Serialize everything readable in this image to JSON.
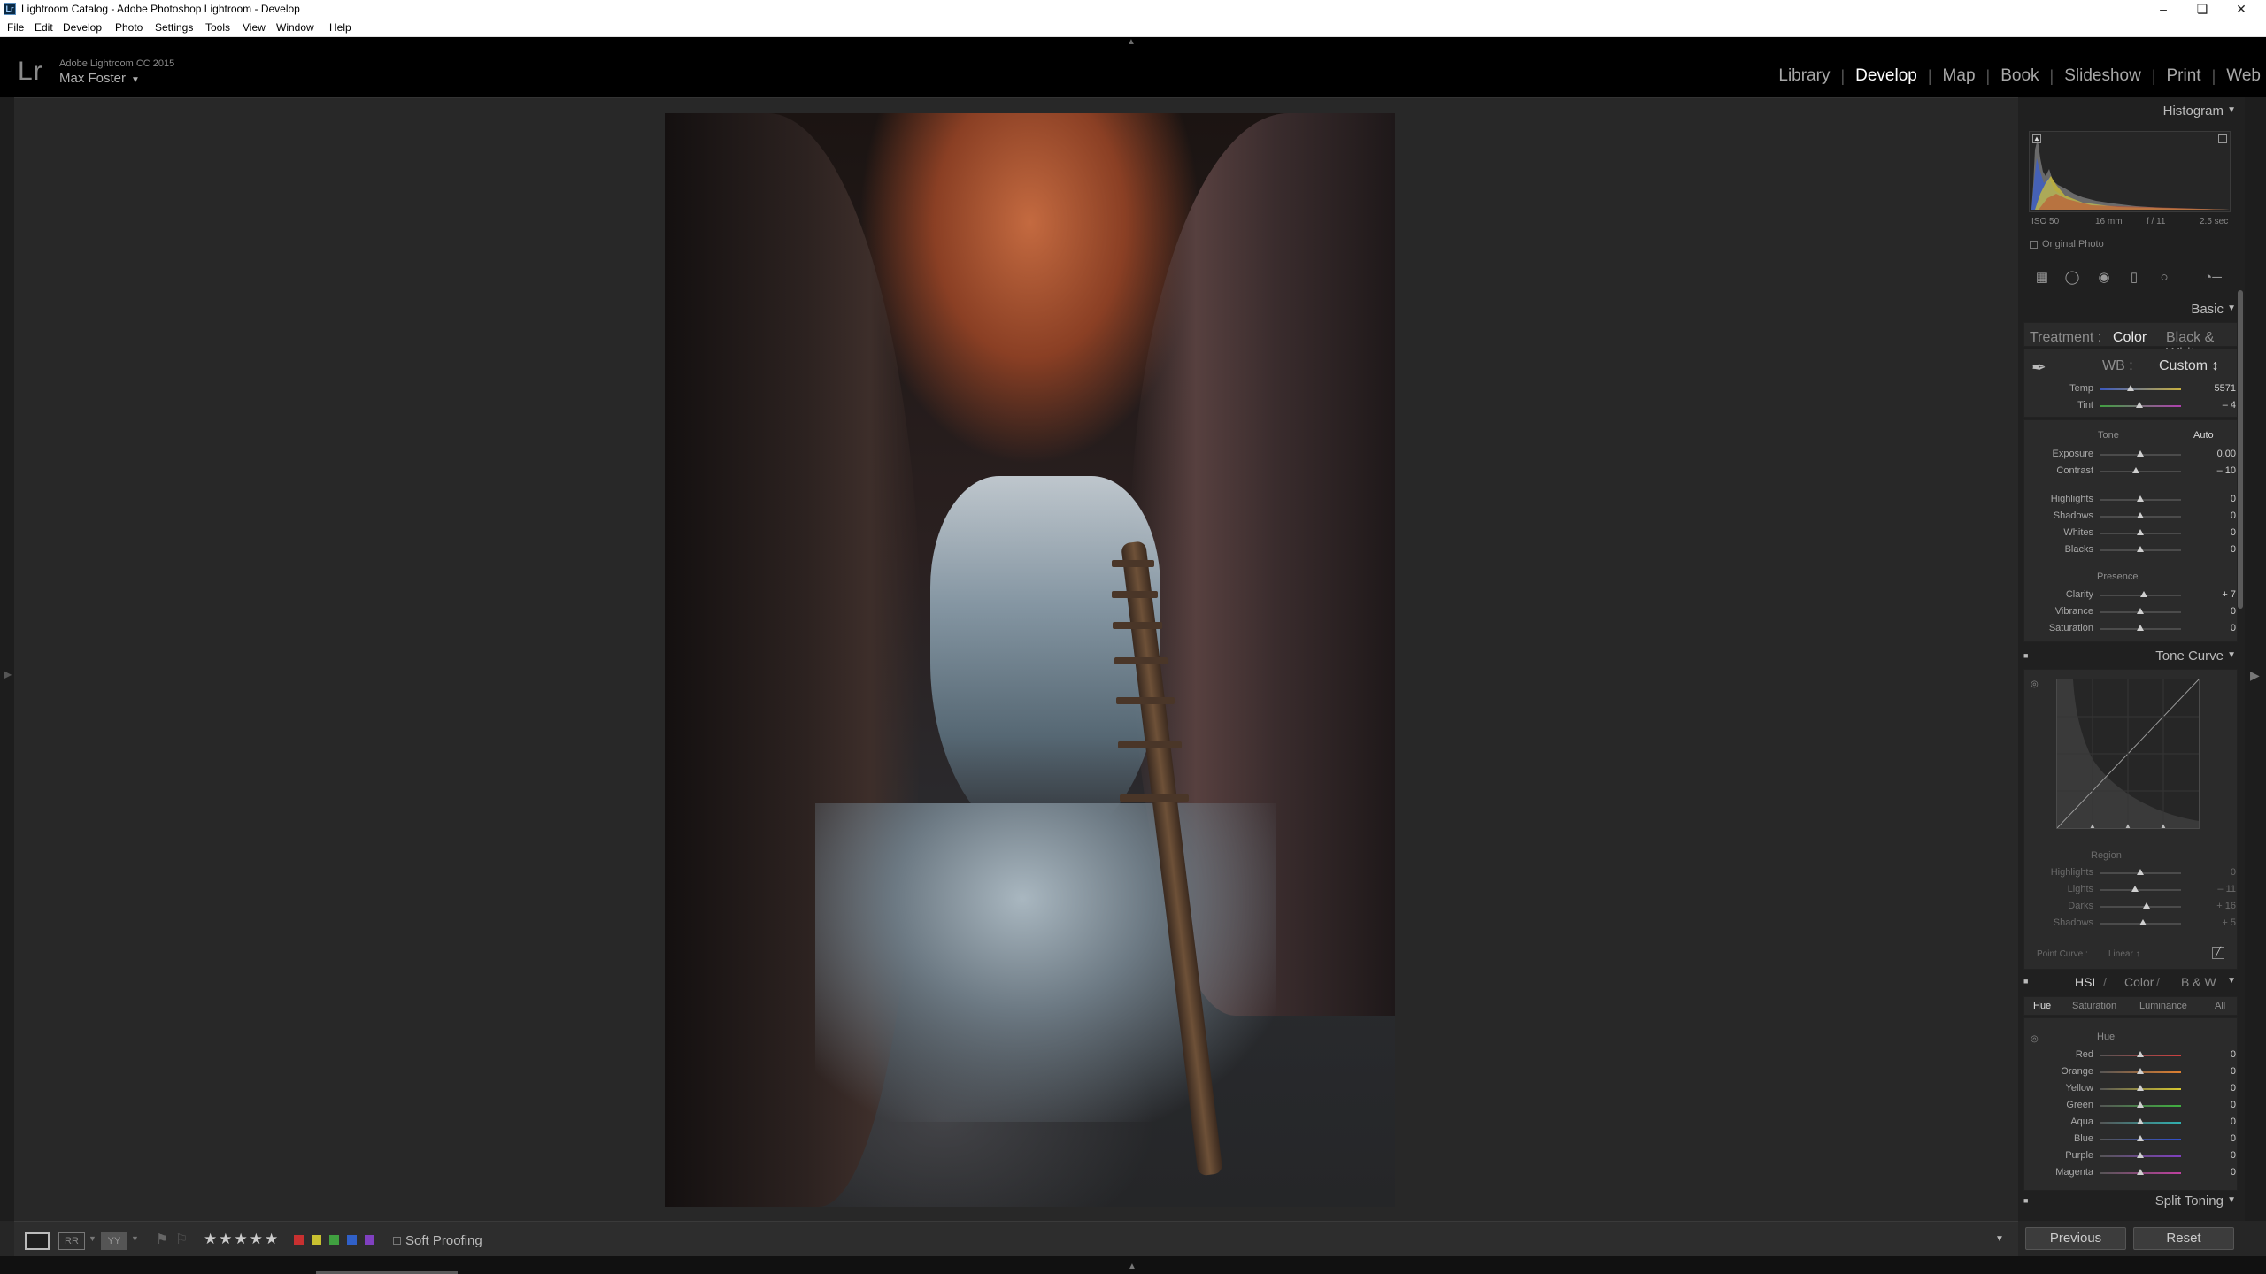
{
  "window": {
    "title": "Lightroom Catalog - Adobe Photoshop Lightroom - Develop",
    "app_icon": "Lr",
    "controls": [
      "–",
      "❏",
      "✕"
    ]
  },
  "menu": [
    "File",
    "Edit",
    "Develop",
    "Photo",
    "Settings",
    "Tools",
    "View",
    "Window",
    "Help"
  ],
  "identity": {
    "logo": "Lr",
    "product": "Adobe Lightroom CC 2015",
    "user": "Max Foster",
    "user_caret": "▼"
  },
  "modules": [
    "Library",
    "Develop",
    "Map",
    "Book",
    "Slideshow",
    "Print",
    "Web"
  ],
  "active_module": "Develop",
  "histogram": {
    "title": "Histogram",
    "exif": [
      "ISO 50",
      "16 mm",
      "f / 11",
      "2.5 sec"
    ],
    "original_photo": "Original Photo"
  },
  "basic": {
    "title": "Basic",
    "treatment_label": "Treatment :",
    "treatment_color": "Color",
    "treatment_bw": "Black & White",
    "wb_label": "WB :",
    "wb_value": "Custom ↕",
    "temp": {
      "label": "Temp",
      "value": "5571",
      "pos": 0.38
    },
    "tint": {
      "label": "Tint",
      "value": "– 4",
      "pos": 0.49
    },
    "tone_label": "Tone",
    "auto_label": "Auto",
    "tone_rows": [
      {
        "label": "Exposure",
        "value": "0.00",
        "pos": 0.5
      },
      {
        "label": "Contrast",
        "value": "– 10",
        "pos": 0.45
      }
    ],
    "light_rows": [
      {
        "label": "Highlights",
        "value": "0",
        "pos": 0.5
      },
      {
        "label": "Shadows",
        "value": "0",
        "pos": 0.5
      },
      {
        "label": "Whites",
        "value": "0",
        "pos": 0.5
      },
      {
        "label": "Blacks",
        "value": "0",
        "pos": 0.5
      }
    ],
    "presence_label": "Presence",
    "presence_rows": [
      {
        "label": "Clarity",
        "value": "+ 7",
        "pos": 0.54
      },
      {
        "label": "Vibrance",
        "value": "0",
        "pos": 0.5
      },
      {
        "label": "Saturation",
        "value": "0",
        "pos": 0.5
      }
    ]
  },
  "tone_curve": {
    "title": "Tone Curve",
    "region_label": "Region",
    "rows": [
      {
        "label": "Highlights",
        "value": "0",
        "pos": 0.5
      },
      {
        "label": "Lights",
        "value": "– 11",
        "pos": 0.44
      },
      {
        "label": "Darks",
        "value": "+ 16",
        "pos": 0.58
      },
      {
        "label": "Shadows",
        "value": "+ 5",
        "pos": 0.53
      }
    ],
    "point_curve_label": "Point Curve :",
    "point_curve_value": "Linear ↕"
  },
  "hsl": {
    "title_hsl": "HSL",
    "title_color": "Color",
    "title_bw": "B & W",
    "tabs": [
      "Hue",
      "Saturation",
      "Luminance",
      "All"
    ],
    "active_tab": "Hue",
    "group_label": "Hue",
    "rows": [
      {
        "label": "Red",
        "value": "0",
        "pos": 0.5,
        "color": "#d04040"
      },
      {
        "label": "Orange",
        "value": "0",
        "pos": 0.5,
        "color": "#e08030"
      },
      {
        "label": "Yellow",
        "value": "0",
        "pos": 0.5,
        "color": "#d8c830"
      },
      {
        "label": "Green",
        "value": "0",
        "pos": 0.5,
        "color": "#40b040"
      },
      {
        "label": "Aqua",
        "value": "0",
        "pos": 0.5,
        "color": "#30b0b0"
      },
      {
        "label": "Blue",
        "value": "0",
        "pos": 0.5,
        "color": "#3050d0"
      },
      {
        "label": "Purple",
        "value": "0",
        "pos": 0.5,
        "color": "#8040c0"
      },
      {
        "label": "Magenta",
        "value": "0",
        "pos": 0.5,
        "color": "#c040a0"
      }
    ]
  },
  "split_toning": {
    "title": "Split Toning"
  },
  "buttons": {
    "previous": "Previous",
    "reset": "Reset"
  },
  "toolbar": {
    "stars": "★★★★★",
    "labels": [
      "#c83030",
      "#c8c030",
      "#40a040",
      "#3060c8",
      "#8040c0"
    ],
    "soft_proofing": "Soft Proofing"
  }
}
